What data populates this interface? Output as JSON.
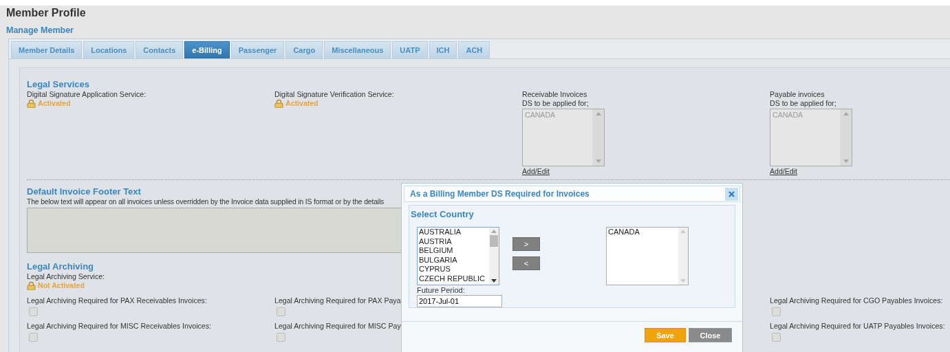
{
  "page_title": "Member Profile",
  "subtitle": "Manage Member",
  "tabs": [
    {
      "label": "Member Details",
      "selected": false
    },
    {
      "label": "Locations",
      "selected": false
    },
    {
      "label": "Contacts",
      "selected": false
    },
    {
      "label": "e-Billing",
      "selected": true
    },
    {
      "label": "Passenger",
      "selected": false
    },
    {
      "label": "Cargo",
      "selected": false
    },
    {
      "label": "Miscellaneous",
      "selected": false
    },
    {
      "label": "UATP",
      "selected": false
    },
    {
      "label": "ICH",
      "selected": false
    },
    {
      "label": "ACH",
      "selected": false
    }
  ],
  "legal_services": {
    "heading": "Legal Services",
    "services": [
      {
        "label": "Digital Signature Application Service:",
        "status": "Activated"
      },
      {
        "label": "Digital Signature Verification Service:",
        "status": "Activated"
      }
    ],
    "ds_lists": [
      {
        "title": "Receivable Invoices",
        "subtitle": "DS to be applied for;",
        "items": [
          "CANADA"
        ],
        "link": "Add/Edit"
      },
      {
        "title": "Payable invoices",
        "subtitle": "DS to be applied for;",
        "items": [
          "CANADA"
        ],
        "link": "Add/Edit"
      }
    ]
  },
  "footer_text": {
    "heading": "Default Invoice Footer Text",
    "description": "The below text will appear on all invoices unless overridden by the Invoice data supplied in IS format or by the details"
  },
  "legal_archiving": {
    "heading": "Legal Archiving",
    "service_label": "Legal Archiving Service:",
    "status": "Not Activated",
    "rows": [
      {
        "left": [
          {
            "label": "Legal Archiving Required for PAX Receivables Invoices:",
            "checked": false
          },
          {
            "label": "Legal Archiving Required for PAX Paya",
            "checked": false
          }
        ],
        "right": [
          {
            "label": "Legal Archiving Required for CGO Payables Invoices:",
            "checked": false
          }
        ]
      },
      {
        "left": [
          {
            "label": "Legal Archiving Required for MISC Receivables Invoices:",
            "checked": false
          },
          {
            "label": "Legal Archiving Required for MISC Pay",
            "checked": false
          }
        ],
        "right": [
          {
            "label": "Legal Archiving Required for UATP Payables Invoices:",
            "checked": false
          }
        ]
      }
    ]
  },
  "dialog": {
    "title": "As a Billing Member DS Required for Invoices",
    "section_heading": "Select Country",
    "available": [
      "AUSTRALIA",
      "AUSTRIA",
      "BELGIUM",
      "BULGARIA",
      "CYPRUS",
      "CZECH REPUBLIC"
    ],
    "chosen": [
      "CANADA"
    ],
    "add_button": ">",
    "remove_button": "<",
    "future_period_label": "Future Period:",
    "future_period_value": "2017-Jul-01",
    "buttons": [
      {
        "label": "Save",
        "kind": "primary"
      },
      {
        "label": "Close",
        "kind": "secondary"
      }
    ]
  }
}
